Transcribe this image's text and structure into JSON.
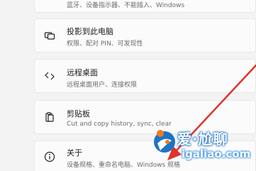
{
  "settings_list": {
    "items": [
      {
        "title": "",
        "subtitle": "蓝牙、设备指示器、不能插入、Windows",
        "icon": "none"
      },
      {
        "title": "投影到此电脑",
        "subtitle": "权限、配对 PIN、可发现性",
        "icon": "project-icon"
      },
      {
        "title": "远程桌面",
        "subtitle": "远程桌面用户、连接权限",
        "icon": "remote-desktop-icon"
      },
      {
        "title": "剪贴板",
        "subtitle": "Cut and copy history, sync, clear",
        "icon": "clipboard-icon"
      },
      {
        "title": "关于",
        "subtitle": "设备规格、重命名电脑、Windows 规格",
        "icon": "info-icon"
      }
    ]
  },
  "watermark": {
    "brand": "爱·尬聊",
    "domain": "igaliao.com"
  },
  "colors": {
    "arrow": "#e0322a",
    "watermark_outline": "#1a6fc4"
  }
}
